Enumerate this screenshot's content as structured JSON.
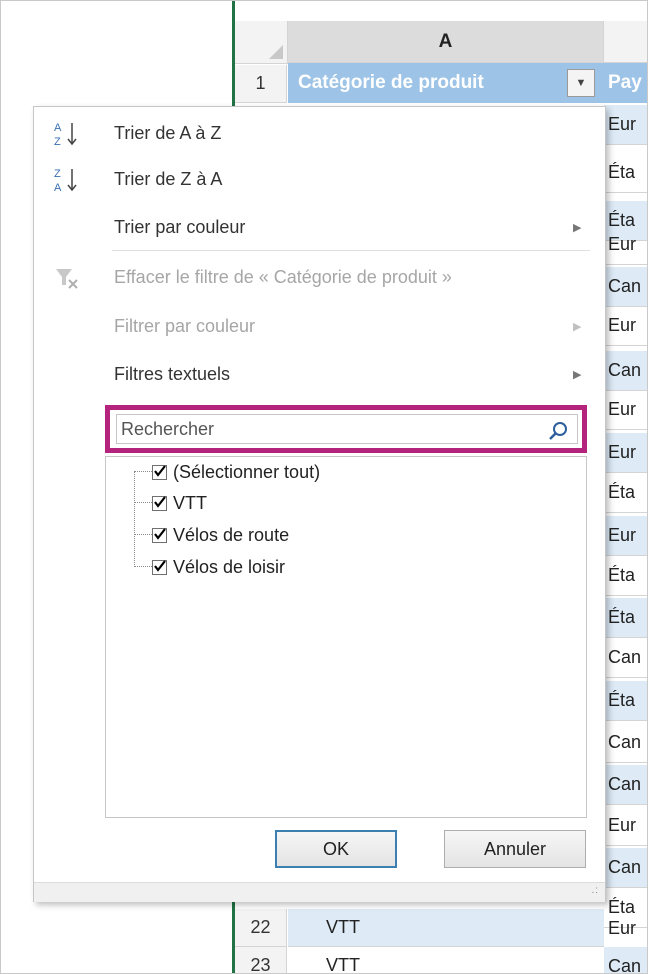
{
  "sheet": {
    "column_a": "A",
    "rows_top": [
      "1"
    ],
    "header_cell": "Catégorie de produit",
    "header_cell_b": "Pay",
    "dropdown_arrow": "▼",
    "column_b_values": [
      "Eur",
      "Éta",
      "Éta",
      "Eur",
      "Can",
      "Eur",
      "Can",
      "Eur",
      "Eur",
      "Éta",
      "Eur",
      "Éta",
      "Éta",
      "Can",
      "Éta",
      "Can",
      "Can",
      "Eur",
      "Can",
      "Éta",
      "Eur",
      "Can"
    ],
    "bottom_rows": [
      {
        "num": "22",
        "a": "VTT",
        "b": "Eur"
      },
      {
        "num": "23",
        "a": "VTT",
        "b": "Can"
      }
    ]
  },
  "menu": {
    "sort_az": "Trier de A à Z",
    "sort_za": "Trier de Z à A",
    "sort_color": "Trier par couleur",
    "clear_filter": "Effacer le filtre de « Catégorie de produit »",
    "filter_color": "Filtrer par couleur",
    "text_filters": "Filtres textuels",
    "submenu_arrow": "▶"
  },
  "search": {
    "placeholder": "Rechercher"
  },
  "tree": {
    "items": [
      {
        "label": "(Sélectionner tout)",
        "checked": true
      },
      {
        "label": "VTT",
        "checked": true
      },
      {
        "label": "Vélos de route",
        "checked": true
      },
      {
        "label": "Vélos de loisir",
        "checked": true
      }
    ]
  },
  "buttons": {
    "ok": "OK",
    "cancel": "Annuler"
  },
  "grip": ".:",
  "colors": {
    "highlight": "#b4247d",
    "header_fill": "#9dc3e6",
    "band_fill": "#deebf7",
    "excel_green": "#217346"
  }
}
